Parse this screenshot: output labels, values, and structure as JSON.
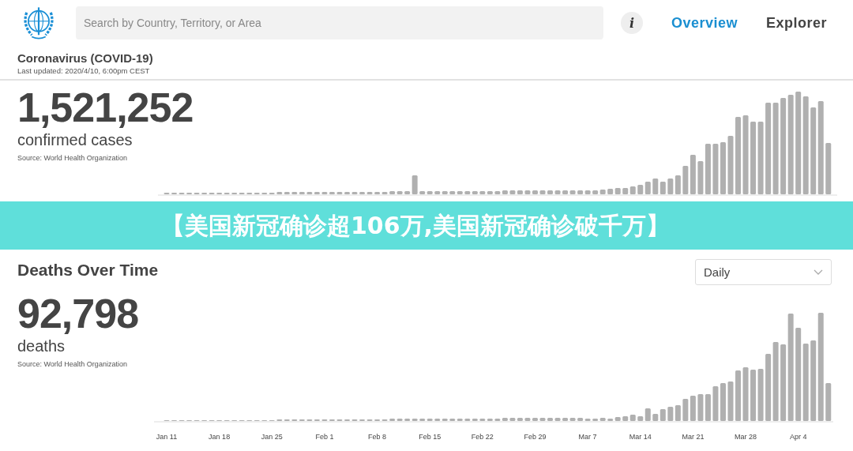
{
  "header": {
    "search": {
      "placeholder": "Search by Country, Territory, or Area"
    },
    "info_button": "i",
    "tabs": [
      {
        "label": "Overview",
        "selected": true
      },
      {
        "label": "Explorer",
        "selected": false
      }
    ],
    "title": "Coronavirus (COVID-19)",
    "last_updated": "Last updated: 2020/4/10, 6:00pm CEST"
  },
  "confirmed": {
    "total": "1,521,252",
    "label": "confirmed cases",
    "source": "Source: World Health Organization"
  },
  "banner": "【美国新冠确诊超106万,美国新冠确诊破千万】",
  "deaths": {
    "title": "Deaths Over Time",
    "period": "Daily",
    "total": "92,798",
    "label": "deaths",
    "source": "Source: World Health Organization",
    "x_labels": [
      "Jan 11",
      "Jan 18",
      "Jan 25",
      "Feb 1",
      "Feb 8",
      "Feb 15",
      "Feb 22",
      "Feb 29",
      "Mar 7",
      "Mar 14",
      "Mar 21",
      "Mar 28",
      "Apr 4"
    ]
  }
}
